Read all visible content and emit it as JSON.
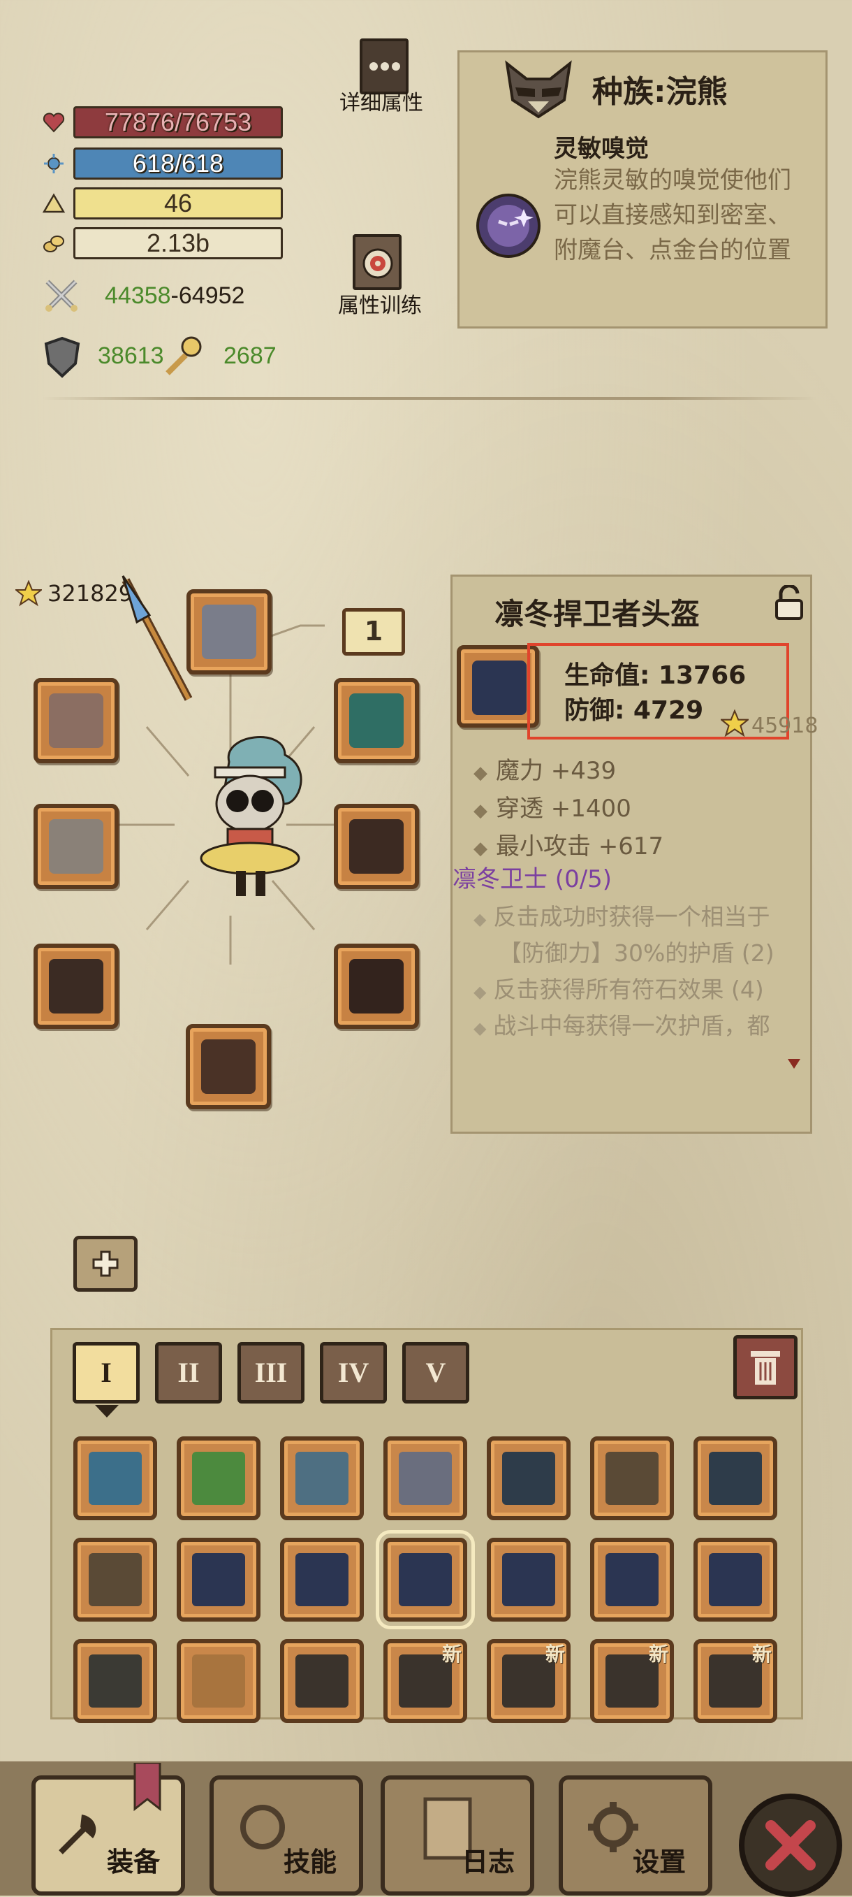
{
  "stats": {
    "hp": "77876/76753",
    "mp": "618/618",
    "level": "46",
    "gold": "2.13b",
    "attack_min": "44358",
    "attack_max": "64952",
    "attack_sep": "-",
    "defense": "38613",
    "luck": "2687"
  },
  "buttons": {
    "detail_attrs": "详细属性",
    "attr_training": "属性训练"
  },
  "race": {
    "title": "种族:浣熊",
    "trait_name": "灵敏嗅觉",
    "trait_desc": "浣熊灵敏的嗅觉使他们可以直接感知到密室、附魔台、点金台的位置"
  },
  "equipment": {
    "total_stars": "321829",
    "page_number": "1"
  },
  "item": {
    "name": "凛冬捍卫者头盔",
    "hp": "生命值: 13766",
    "defense": "防御: 4729",
    "stars": "45918",
    "affixes": [
      "魔力 +439",
      "穿透 +1400",
      "最小攻击 +617"
    ],
    "set_name": "凛冬卫士 (0/5)",
    "set_bonuses": [
      "反击成功时获得一个相当于",
      "【防御力】30%的护盾 (2)",
      "反击获得所有符石效果 (4)",
      "战斗中每获得一次护盾，都"
    ]
  },
  "inventory": {
    "tabs": [
      "I",
      "II",
      "III",
      "IV",
      "V"
    ],
    "new_badge": "新"
  },
  "nav": {
    "equip": "装备",
    "skills": "技能",
    "log": "日志",
    "settings": "设置"
  },
  "colors": {
    "hp_bar": "#8e3b3e",
    "mp_bar": "#4e86b6",
    "level_bar": "#efe08e",
    "set_purple": "#7b3fa0",
    "highlight_red": "#e0442c"
  }
}
